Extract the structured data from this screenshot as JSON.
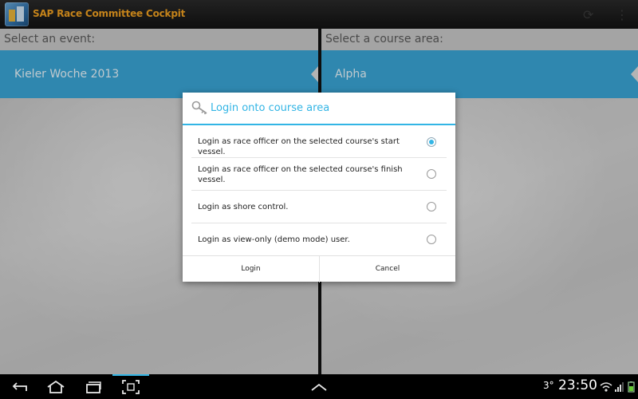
{
  "app": {
    "title": "SAP Race Committee Cockpit",
    "accent_color": "#33b5e5",
    "title_color": "#f0a020"
  },
  "left_pane": {
    "header": "Select an event:",
    "selected_item": "Kieler Woche 2013"
  },
  "right_pane": {
    "header": "Select a course area:",
    "selected_item": "Alpha"
  },
  "dialog": {
    "title": "Login onto course area",
    "icon": "key-icon",
    "options": [
      {
        "label": "Login as race officer on the selected course's start vessel.",
        "checked": true
      },
      {
        "label": "Login as race officer on the selected course's finish vessel.",
        "checked": false
      },
      {
        "label": "Login as shore control.",
        "checked": false
      },
      {
        "label": "Login as view-only (demo mode) user.",
        "checked": false
      }
    ],
    "login_label": "Login",
    "cancel_label": "Cancel"
  },
  "system_bar": {
    "temperature": "3°",
    "time": "23:50",
    "nav_icons": [
      "back-icon",
      "home-icon",
      "recent-apps-icon",
      "screenshot-icon",
      "chevron-up-icon"
    ],
    "status_icons": [
      "wifi-icon",
      "signal-icon",
      "battery-icon"
    ]
  }
}
